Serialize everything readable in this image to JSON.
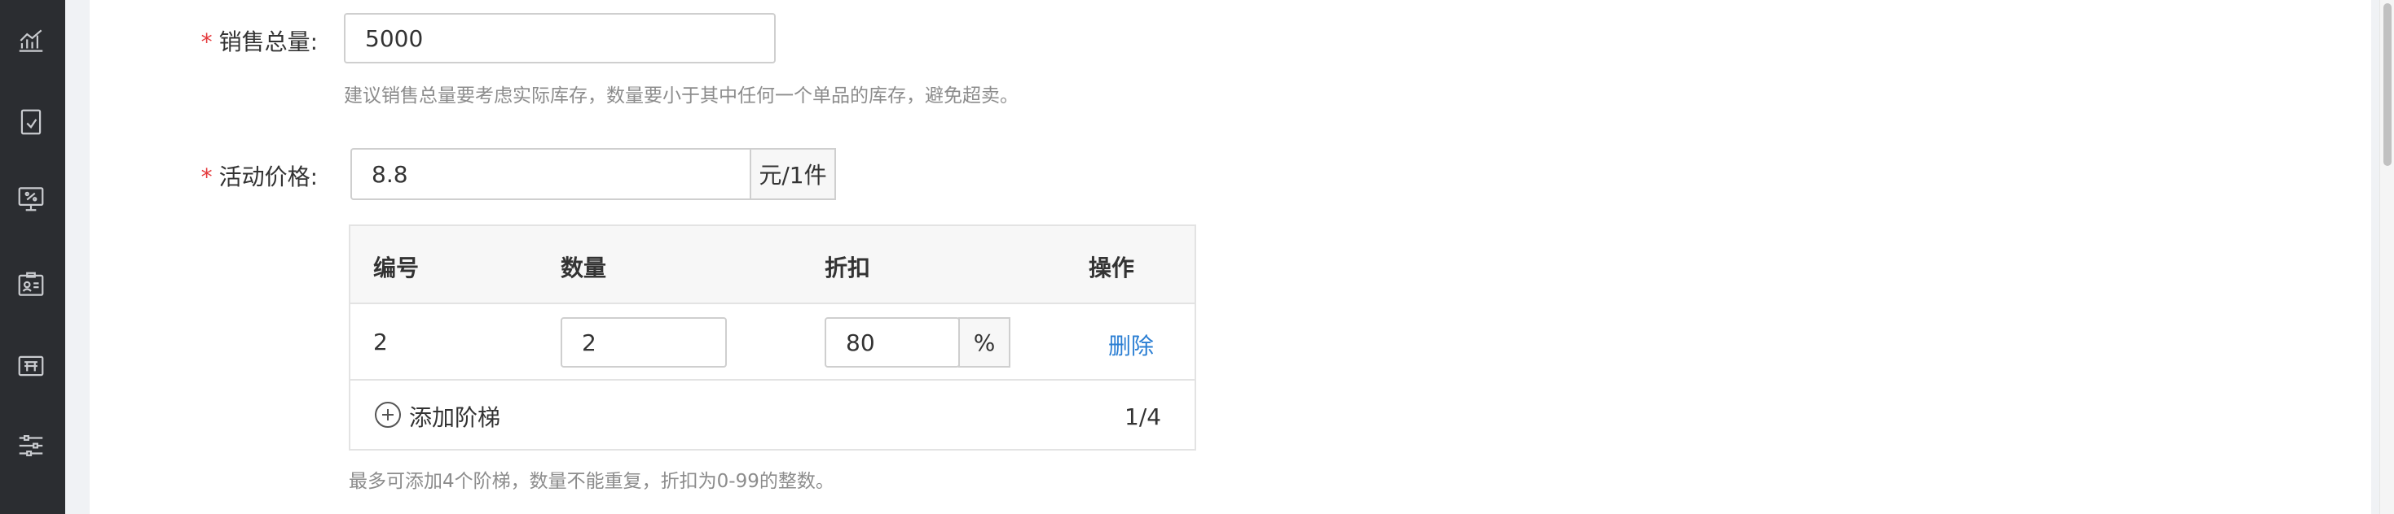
{
  "sidebar": {
    "items": [
      {
        "icon": "chart-icon"
      },
      {
        "icon": "document-edit-icon"
      },
      {
        "icon": "discount-monitor-icon"
      },
      {
        "icon": "id-card-icon"
      },
      {
        "icon": "ticket-icon"
      },
      {
        "icon": "sliders-icon"
      }
    ]
  },
  "form": {
    "required_mark": "*",
    "sales_total": {
      "label": "销售总量:",
      "value": "5000",
      "hint": "建议销售总量要考虑实际库存，数量要小于其中任何一个单品的库存，避免超卖。"
    },
    "activity_price": {
      "label": "活动价格:",
      "value": "8.8",
      "unit": "元/1件"
    }
  },
  "tier_table": {
    "headers": [
      "编号",
      "数量",
      "折扣",
      "操作"
    ],
    "rows": [
      {
        "no": "2",
        "quantity": "2",
        "discount": "80",
        "discount_unit": "%",
        "action": "删除"
      }
    ],
    "add_label": "添加阶梯",
    "count": "1/4",
    "hint": "最多可添加4个阶梯，数量不能重复，折扣为0-99的整数。"
  },
  "colors": {
    "sidebar_bg": "#2b2d31",
    "required": "#e4393c",
    "link": "#2a7ed3"
  }
}
